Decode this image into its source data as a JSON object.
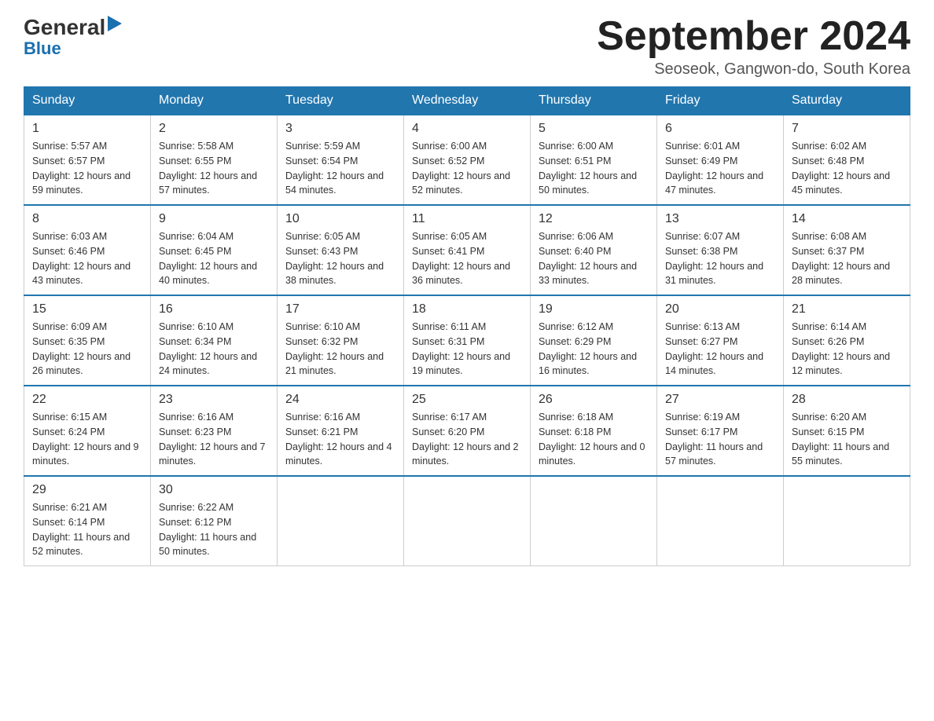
{
  "header": {
    "logo": {
      "general": "General",
      "arrow": "▶",
      "blue": "Blue"
    },
    "title": "September 2024",
    "location": "Seoseok, Gangwon-do, South Korea"
  },
  "weekdays": [
    "Sunday",
    "Monday",
    "Tuesday",
    "Wednesday",
    "Thursday",
    "Friday",
    "Saturday"
  ],
  "weeks": [
    [
      {
        "day": "1",
        "sunrise": "5:57 AM",
        "sunset": "6:57 PM",
        "daylight": "12 hours and 59 minutes."
      },
      {
        "day": "2",
        "sunrise": "5:58 AM",
        "sunset": "6:55 PM",
        "daylight": "12 hours and 57 minutes."
      },
      {
        "day": "3",
        "sunrise": "5:59 AM",
        "sunset": "6:54 PM",
        "daylight": "12 hours and 54 minutes."
      },
      {
        "day": "4",
        "sunrise": "6:00 AM",
        "sunset": "6:52 PM",
        "daylight": "12 hours and 52 minutes."
      },
      {
        "day": "5",
        "sunrise": "6:00 AM",
        "sunset": "6:51 PM",
        "daylight": "12 hours and 50 minutes."
      },
      {
        "day": "6",
        "sunrise": "6:01 AM",
        "sunset": "6:49 PM",
        "daylight": "12 hours and 47 minutes."
      },
      {
        "day": "7",
        "sunrise": "6:02 AM",
        "sunset": "6:48 PM",
        "daylight": "12 hours and 45 minutes."
      }
    ],
    [
      {
        "day": "8",
        "sunrise": "6:03 AM",
        "sunset": "6:46 PM",
        "daylight": "12 hours and 43 minutes."
      },
      {
        "day": "9",
        "sunrise": "6:04 AM",
        "sunset": "6:45 PM",
        "daylight": "12 hours and 40 minutes."
      },
      {
        "day": "10",
        "sunrise": "6:05 AM",
        "sunset": "6:43 PM",
        "daylight": "12 hours and 38 minutes."
      },
      {
        "day": "11",
        "sunrise": "6:05 AM",
        "sunset": "6:41 PM",
        "daylight": "12 hours and 36 minutes."
      },
      {
        "day": "12",
        "sunrise": "6:06 AM",
        "sunset": "6:40 PM",
        "daylight": "12 hours and 33 minutes."
      },
      {
        "day": "13",
        "sunrise": "6:07 AM",
        "sunset": "6:38 PM",
        "daylight": "12 hours and 31 minutes."
      },
      {
        "day": "14",
        "sunrise": "6:08 AM",
        "sunset": "6:37 PM",
        "daylight": "12 hours and 28 minutes."
      }
    ],
    [
      {
        "day": "15",
        "sunrise": "6:09 AM",
        "sunset": "6:35 PM",
        "daylight": "12 hours and 26 minutes."
      },
      {
        "day": "16",
        "sunrise": "6:10 AM",
        "sunset": "6:34 PM",
        "daylight": "12 hours and 24 minutes."
      },
      {
        "day": "17",
        "sunrise": "6:10 AM",
        "sunset": "6:32 PM",
        "daylight": "12 hours and 21 minutes."
      },
      {
        "day": "18",
        "sunrise": "6:11 AM",
        "sunset": "6:31 PM",
        "daylight": "12 hours and 19 minutes."
      },
      {
        "day": "19",
        "sunrise": "6:12 AM",
        "sunset": "6:29 PM",
        "daylight": "12 hours and 16 minutes."
      },
      {
        "day": "20",
        "sunrise": "6:13 AM",
        "sunset": "6:27 PM",
        "daylight": "12 hours and 14 minutes."
      },
      {
        "day": "21",
        "sunrise": "6:14 AM",
        "sunset": "6:26 PM",
        "daylight": "12 hours and 12 minutes."
      }
    ],
    [
      {
        "day": "22",
        "sunrise": "6:15 AM",
        "sunset": "6:24 PM",
        "daylight": "12 hours and 9 minutes."
      },
      {
        "day": "23",
        "sunrise": "6:16 AM",
        "sunset": "6:23 PM",
        "daylight": "12 hours and 7 minutes."
      },
      {
        "day": "24",
        "sunrise": "6:16 AM",
        "sunset": "6:21 PM",
        "daylight": "12 hours and 4 minutes."
      },
      {
        "day": "25",
        "sunrise": "6:17 AM",
        "sunset": "6:20 PM",
        "daylight": "12 hours and 2 minutes."
      },
      {
        "day": "26",
        "sunrise": "6:18 AM",
        "sunset": "6:18 PM",
        "daylight": "12 hours and 0 minutes."
      },
      {
        "day": "27",
        "sunrise": "6:19 AM",
        "sunset": "6:17 PM",
        "daylight": "11 hours and 57 minutes."
      },
      {
        "day": "28",
        "sunrise": "6:20 AM",
        "sunset": "6:15 PM",
        "daylight": "11 hours and 55 minutes."
      }
    ],
    [
      {
        "day": "29",
        "sunrise": "6:21 AM",
        "sunset": "6:14 PM",
        "daylight": "11 hours and 52 minutes."
      },
      {
        "day": "30",
        "sunrise": "6:22 AM",
        "sunset": "6:12 PM",
        "daylight": "11 hours and 50 minutes."
      },
      null,
      null,
      null,
      null,
      null
    ]
  ]
}
